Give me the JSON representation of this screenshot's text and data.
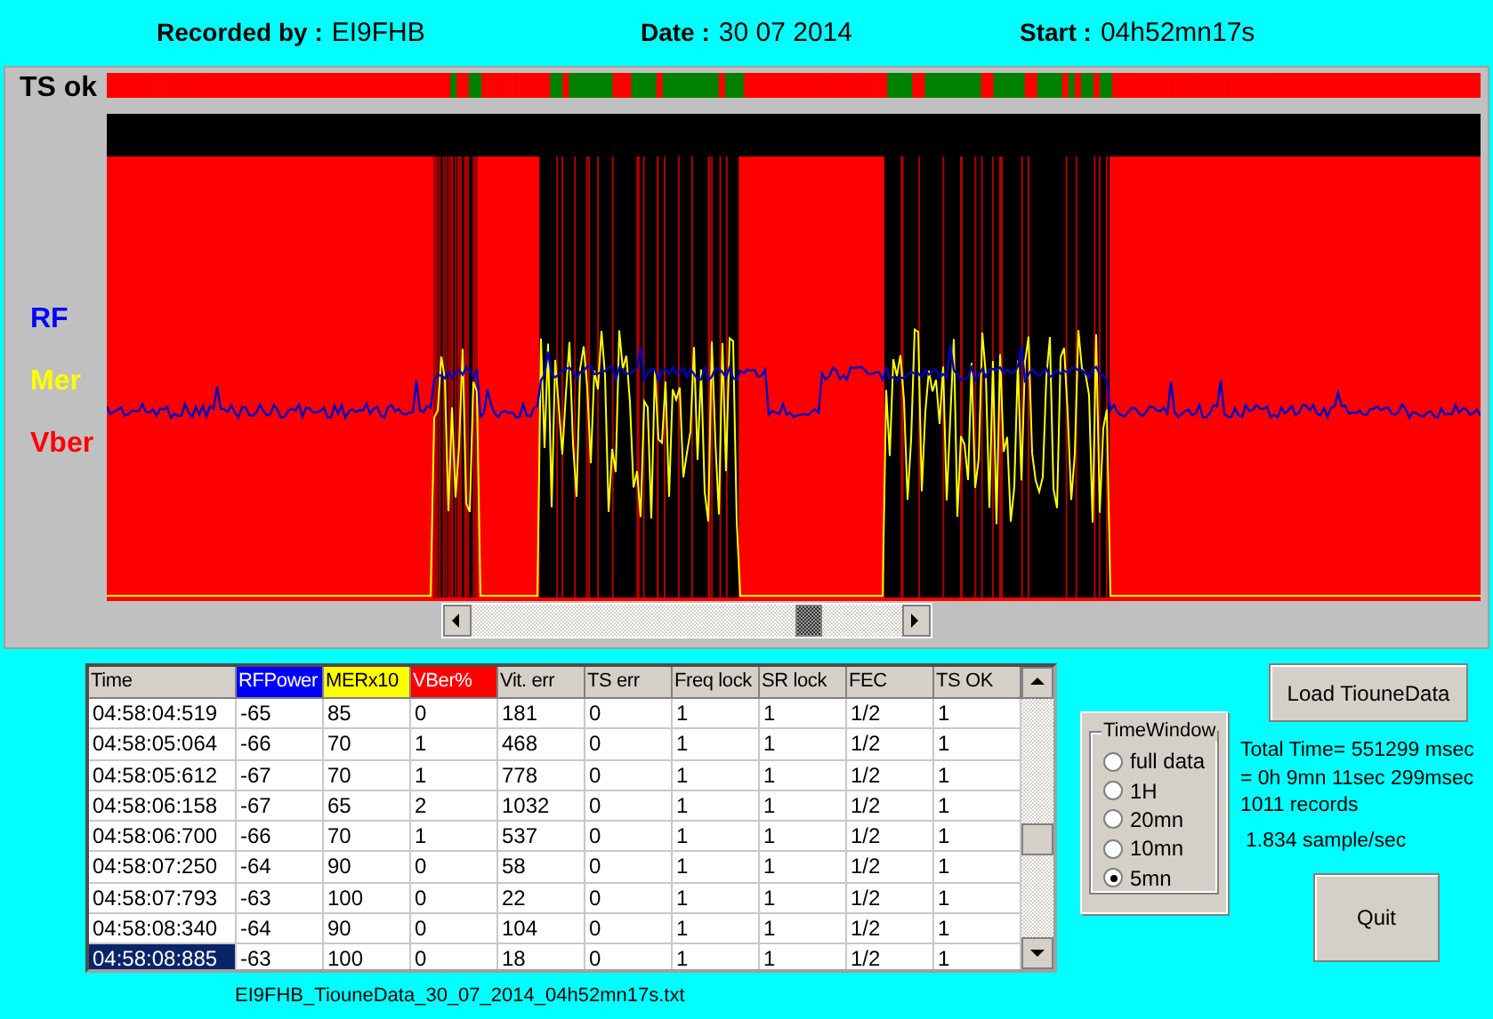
{
  "header": [
    {
      "label": "Recorded by :",
      "value": "EI9FHB"
    },
    {
      "label": "Date :",
      "value": "30 07 2014"
    },
    {
      "label": "Start :",
      "value": "04h52mn17s"
    }
  ],
  "ts_label": "TS ok",
  "legend": [
    {
      "label": "RF",
      "color": "#0000ff"
    },
    {
      "label": "Mer",
      "color": "#ffff00"
    },
    {
      "label": "Vber",
      "color": "#ff0000"
    }
  ],
  "table": {
    "columns": [
      {
        "label": "Time"
      },
      {
        "label": "RFPower",
        "color": "#0000ff"
      },
      {
        "label": "MERx10",
        "color": "#ffff00"
      },
      {
        "label": "VBer%",
        "color": "#ff0000"
      },
      {
        "label": "Vit. err"
      },
      {
        "label": "TS err"
      },
      {
        "label": "Freq lock"
      },
      {
        "label": "SR lock"
      },
      {
        "label": "FEC"
      },
      {
        "label": "TS OK"
      }
    ],
    "rows": [
      {
        "selected": false,
        "cells": [
          "04:58:04:519",
          "-65",
          "85",
          "0",
          "181",
          "0",
          "1",
          "1",
          "1/2",
          "1"
        ]
      },
      {
        "selected": false,
        "cells": [
          "04:58:05:064",
          "-66",
          "70",
          "1",
          "468",
          "0",
          "1",
          "1",
          "1/2",
          "1"
        ]
      },
      {
        "selected": false,
        "cells": [
          "04:58:05:612",
          "-67",
          "70",
          "1",
          "778",
          "0",
          "1",
          "1",
          "1/2",
          "1"
        ]
      },
      {
        "selected": false,
        "cells": [
          "04:58:06:158",
          "-67",
          "65",
          "2",
          "1032",
          "0",
          "1",
          "1",
          "1/2",
          "1"
        ]
      },
      {
        "selected": false,
        "cells": [
          "04:58:06:700",
          "-66",
          "70",
          "1",
          "537",
          "0",
          "1",
          "1",
          "1/2",
          "1"
        ]
      },
      {
        "selected": false,
        "cells": [
          "04:58:07:250",
          "-64",
          "90",
          "0",
          "58",
          "0",
          "1",
          "1",
          "1/2",
          "1"
        ]
      },
      {
        "selected": false,
        "cells": [
          "04:58:07:793",
          "-63",
          "100",
          "0",
          "22",
          "0",
          "1",
          "1",
          "1/2",
          "1"
        ]
      },
      {
        "selected": false,
        "cells": [
          "04:58:08:340",
          "-64",
          "90",
          "0",
          "104",
          "0",
          "1",
          "1",
          "1/2",
          "1"
        ]
      },
      {
        "selected": true,
        "cells": [
          "04:58:08:885",
          "-63",
          "100",
          "0",
          "18",
          "0",
          "1",
          "1",
          "1/2",
          "1"
        ]
      }
    ]
  },
  "filename": "EI9FHB_TiouneData_30_07_2014_04h52mn17s.txt",
  "time_window": {
    "title": "TimeWindow",
    "options": [
      {
        "label": "full data",
        "selected": false
      },
      {
        "label": "1H",
        "selected": false
      },
      {
        "label": "20mn",
        "selected": false
      },
      {
        "label": "10mn",
        "selected": false
      },
      {
        "label": "5mn",
        "selected": true
      }
    ]
  },
  "load_button": "Load TiouneData",
  "stats": [
    "Total Time= 551299 msec",
    "= 0h 9mn 11sec 299msec",
    "1011 records",
    "1.834 sample/sec"
  ],
  "quit_button": "Quit"
}
